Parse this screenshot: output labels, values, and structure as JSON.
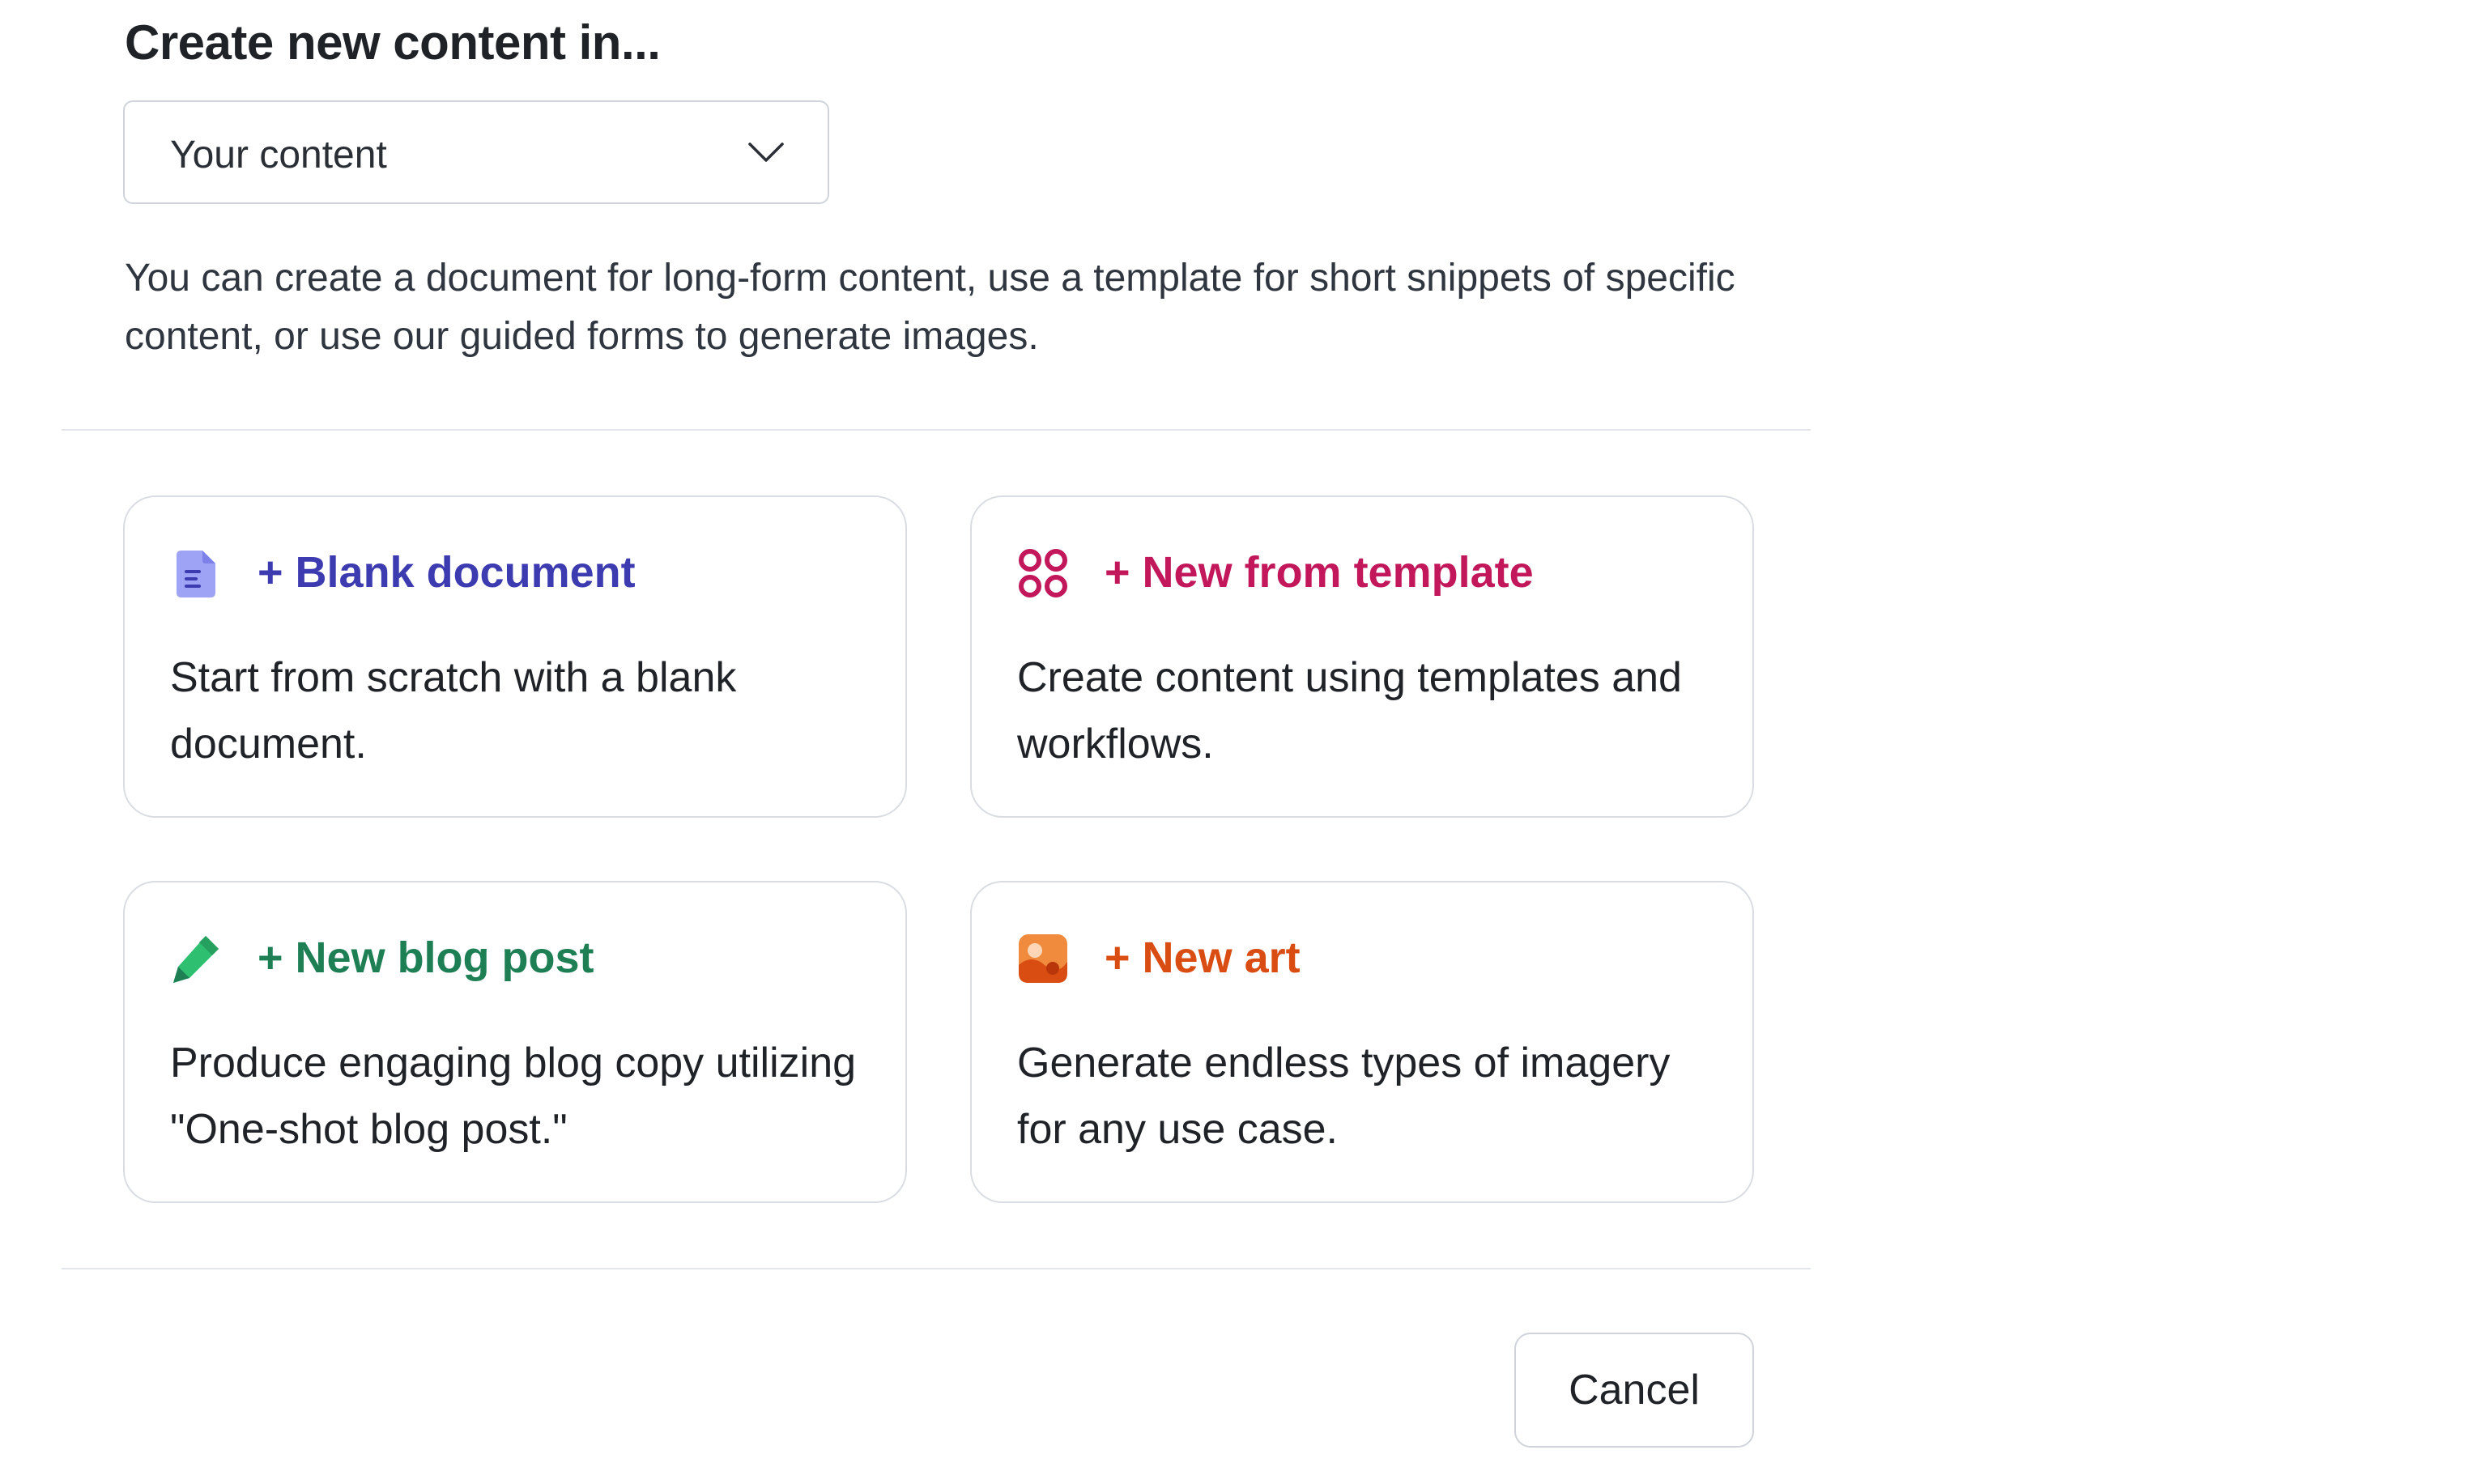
{
  "dialog": {
    "title": "Create new content in...",
    "location_select": {
      "value": "Your content"
    },
    "description": "You can create a document for long-form content, use a template for short snippets of specific content, or use our guided forms to generate images.",
    "options": [
      {
        "title": "+ Blank document",
        "description": "Start from scratch with a blank document.",
        "icon": "document-icon",
        "color": "#3d3bb0"
      },
      {
        "title": "+ New from template",
        "description": "Create content using templates and workflows.",
        "icon": "template-grid-icon",
        "color": "#c2185b"
      },
      {
        "title": "+ New blog post",
        "description": "Produce engaging blog copy utilizing \"One-shot blog post.\"",
        "icon": "pen-icon",
        "color": "#1e7f55"
      },
      {
        "title": "+ New art",
        "description": "Generate endless types of imagery for any use case.",
        "icon": "image-art-icon",
        "color": "#d94d12"
      }
    ],
    "cancel_label": "Cancel"
  }
}
